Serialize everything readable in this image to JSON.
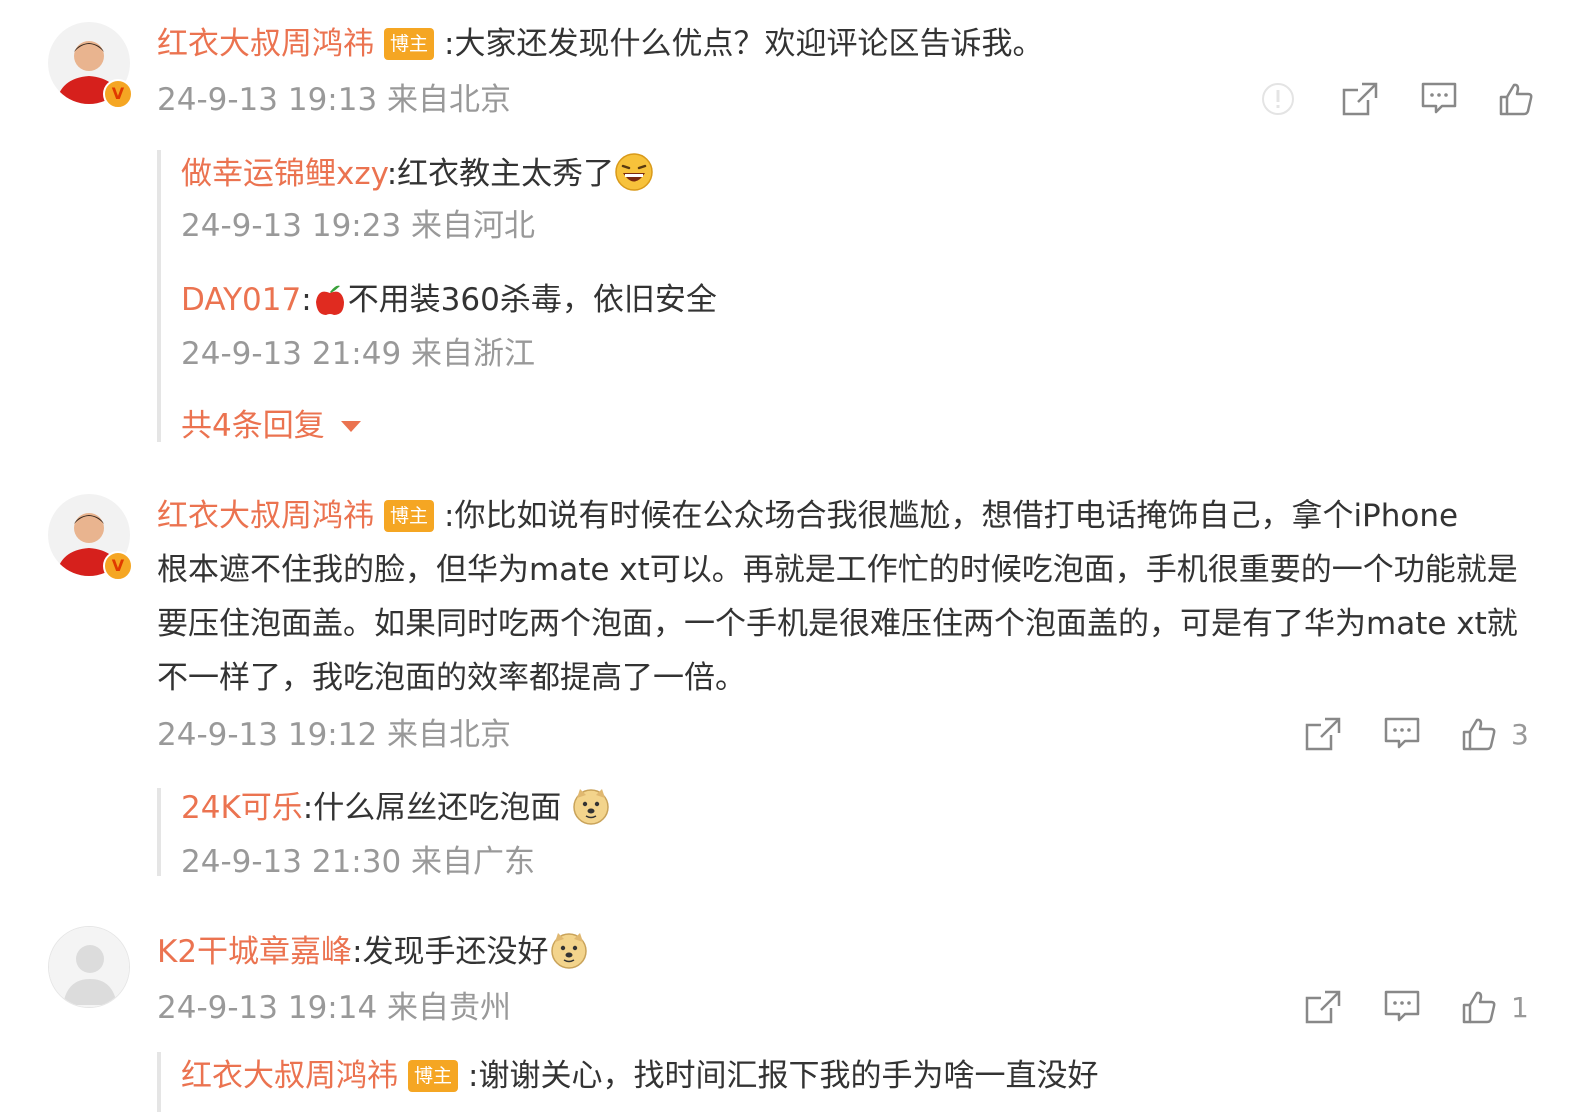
{
  "comments": [
    {
      "user": "红衣大叔周鸿祎",
      "badge": "博主",
      "text": ":大家还发现什么优点？欢迎评论区告诉我。",
      "time": "24-9-13 19:13 来自北京",
      "replies": [
        {
          "user": "做幸运锦鲤xzy",
          "text": ":红衣教主太秀了",
          "time": "24-9-13 19:23 来自河北"
        },
        {
          "user": "DAY017",
          "text_prefix": ":",
          "text": "不用装360杀毒，依旧安全",
          "time": "24-9-13 21:49 来自浙江"
        }
      ],
      "more_replies": "共4条回复"
    },
    {
      "user": "红衣大叔周鸿祎",
      "badge": "博主",
      "text_line1": ":你比如说有时候在公众场合我很尴尬，想借打电话掩饰自己，拿个iPhone",
      "text_rest": "根本遮不住我的脸，但华为mate xt可以。再就是工作忙的时候吃泡面，手机很重要的一个功能就是要压住泡面盖。如果同时吃两个泡面，一个手机是很难压住两个泡面盖的，可是有了华为mate xt就不一样了，我吃泡面的效率都提高了一倍。",
      "time": "24-9-13 19:12 来自北京",
      "like_count": "3",
      "replies": [
        {
          "user": "24K可乐",
          "text": ":什么屌丝还吃泡面 ",
          "time": "24-9-13 21:30 来自广东"
        }
      ]
    },
    {
      "user": "K2干城章嘉峰",
      "text": ":发现手还没好",
      "time": "24-9-13 19:14 来自贵州",
      "like_count": "1",
      "replies": [
        {
          "user": "红衣大叔周鸿祎",
          "badge": "博主",
          "text": ":谢谢关心，找时间汇报下我的手为啥一直没好"
        }
      ]
    }
  ],
  "icons": {
    "report": "report-icon",
    "share": "share-icon",
    "comment": "comment-icon",
    "like": "like-icon",
    "verified": "verified-badge-icon",
    "caret": "caret-down-icon"
  },
  "colors": {
    "username": "#eb7350",
    "badge": "#f5a623",
    "meta": "#999999",
    "text": "#333333"
  }
}
